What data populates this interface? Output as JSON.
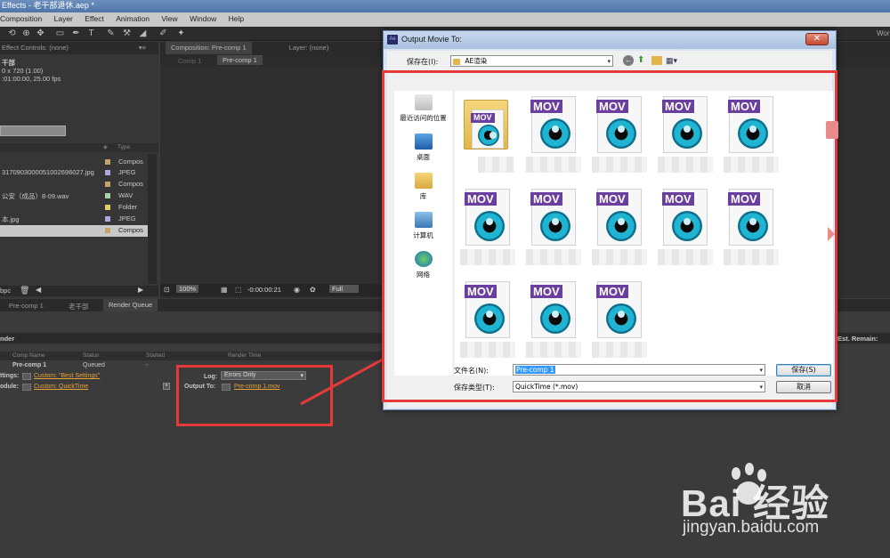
{
  "app": {
    "title": "Effects - 老干部退休.aep *",
    "menus": [
      "Composition",
      "Layer",
      "Effect",
      "Animation",
      "View",
      "Window",
      "Help"
    ],
    "workspace_label": "Wor"
  },
  "left_panel": {
    "tab": "Effect Controls: (none)",
    "item_name": "干部",
    "item_res": "0 x 720 (1.00)",
    "item_duration": ":01:00:00, 25.00 fps",
    "type_header": "Type",
    "rows": [
      {
        "name": "",
        "type": "Compos",
        "color": "#c2a36a"
      },
      {
        "name": "317090300005100269​6027.jpg",
        "type": "JPEG",
        "color": "#a9a9d9"
      },
      {
        "name": "",
        "type": "Compos",
        "color": "#c2a36a"
      },
      {
        "name": "公安（成品）8-09.wav",
        "type": "WAV",
        "color": "#a8d1a8"
      },
      {
        "name": "",
        "type": "Folder",
        "color": "#e0cf6a"
      },
      {
        "name": "本.jpg",
        "type": "JPEG",
        "color": "#a9a9d9"
      },
      {
        "name": "",
        "type": "Compos",
        "color": "#c2a36a"
      }
    ],
    "bpc": "bpc"
  },
  "comp_panel": {
    "tab": "Composition: Pre-comp 1",
    "layer_tab": "Layer: (none)",
    "sub_tab_1": "Comp 1",
    "sub_tab_2": "Pre-comp 1",
    "zoom": "100%",
    "timecode": "-0:00:00:21",
    "resolution": "Full"
  },
  "bottom_tabs": [
    "Pre-comp 1",
    "老干部",
    "Render Queue"
  ],
  "render_queue": {
    "section_label": "nder",
    "est_remain": "Est. Remain:",
    "cols": [
      "Comp Name",
      "Status",
      "Started",
      "Render Time"
    ],
    "item_name": "Pre-comp 1",
    "item_status": "Queued",
    "item_started": "-",
    "settings_label": "ttings:",
    "settings_value": "Custom: \"Best Settings\"",
    "module_label": "odule:",
    "module_value": "Custom: QuickTime",
    "log_label": "Log:",
    "log_value": "Errors Only",
    "output_label": "Output To:",
    "output_value": "Pre-comp 1.mov"
  },
  "dialog": {
    "title": "Output Movie To:",
    "save_in_label": "保存在(I):",
    "save_in_value": "AE渲染",
    "places": [
      "最近访问的位置",
      "桌面",
      "库",
      "计算机",
      "网络"
    ],
    "file_badge": "MOV",
    "filename_label": "文件名(N):",
    "filename_value": "Pre-comp 1",
    "filetype_label": "保存类型(T):",
    "filetype_value": "QuickTime (*.mov)",
    "save_button": "保存(S)",
    "cancel_button": "取消"
  },
  "watermark": {
    "brand": "Bai 经验",
    "url": "jingyan.baidu.com"
  },
  "colors": {
    "annotation_red": "#e53a3a",
    "mov_purple": "#6b3fa0",
    "link_orange": "#e8a33a"
  }
}
